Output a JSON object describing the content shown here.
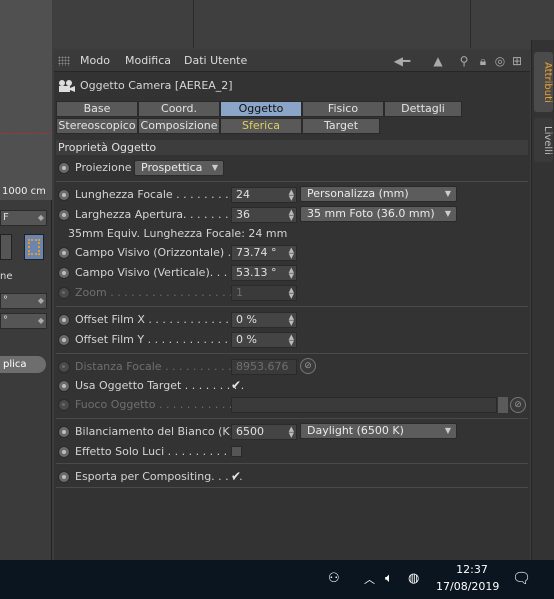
{
  "viewport": {
    "scale_label": "1000 cm"
  },
  "left_panel": {
    "field1": "F",
    "field2": "°",
    "field3": "°",
    "label_ne": "ne",
    "button_label": "plica"
  },
  "side_tabs": {
    "attributi": "Attributi",
    "livelli": "Livelli"
  },
  "menubar": {
    "items": [
      "Modo",
      "Modifica",
      "Dati Utente"
    ]
  },
  "object_title": "Oggetto Camera [AEREA_2]",
  "tabs_row1": [
    "Base",
    "Coord.",
    "Oggetto",
    "Fisico",
    "Dettagli"
  ],
  "tabs_row2": [
    "Stereoscopico",
    "Composizione",
    "Sferica",
    "Target"
  ],
  "active_tab": "Oggetto",
  "section_header": "Proprietà Oggetto",
  "fields": {
    "proiezione": {
      "label": "Proiezione",
      "value": "Prospettica"
    },
    "lunghezza_focale": {
      "label": "Lunghezza Focale . . . . . . . . . .",
      "value": "24",
      "preset": "Personalizza (mm)"
    },
    "larghezza_apertura": {
      "label": "Larghezza Apertura. . . . . . . . .",
      "value": "36",
      "preset": "35 mm Foto (36.0 mm)"
    },
    "equiv": "35mm Equiv. Lunghezza Focale: 24 mm",
    "campo_orizz": {
      "label": "Campo Visivo (Orizzontale) . .",
      "value": "73.74 °"
    },
    "campo_vert": {
      "label": "Campo Visivo (Verticale). . . . .",
      "value": "53.13 °"
    },
    "zoom": {
      "label": "Zoom . . . . . . . . . . . . . . . . . . . .",
      "value": "1"
    },
    "offset_x": {
      "label": "Offset Film X . . . . . . . . . . . . . .",
      "value": "0 %"
    },
    "offset_y": {
      "label": "Offset Film Y . . . . . . . . . . . . . .",
      "value": "0 %"
    },
    "distanza_focale": {
      "label": "Distanza Focale . . . . . . . . . . .",
      "value": "8953.676"
    },
    "usa_target": {
      "label": "Usa Oggetto Target . . . . . . . . .",
      "checked": "✔"
    },
    "fuoco_oggetto": {
      "label": "Fuoco Oggetto . . . . . . . . . . . ."
    },
    "bilanciamento": {
      "label": "Bilanciamento del Bianco (K)",
      "value": "6500",
      "preset": "Daylight (6500 K)"
    },
    "effetto_luci": {
      "label": "Effetto Solo Luci . . . . . . . . . ."
    },
    "esporta": {
      "label": "Esporta per Compositing. . . . .",
      "checked": "✔"
    }
  },
  "taskbar": {
    "time": "12:37",
    "date": "17/08/2019"
  },
  "colors": {
    "active_tab": "#8aa5c8",
    "attributi_tab_text": "#e8a232",
    "taskbar": "#0a1520"
  }
}
